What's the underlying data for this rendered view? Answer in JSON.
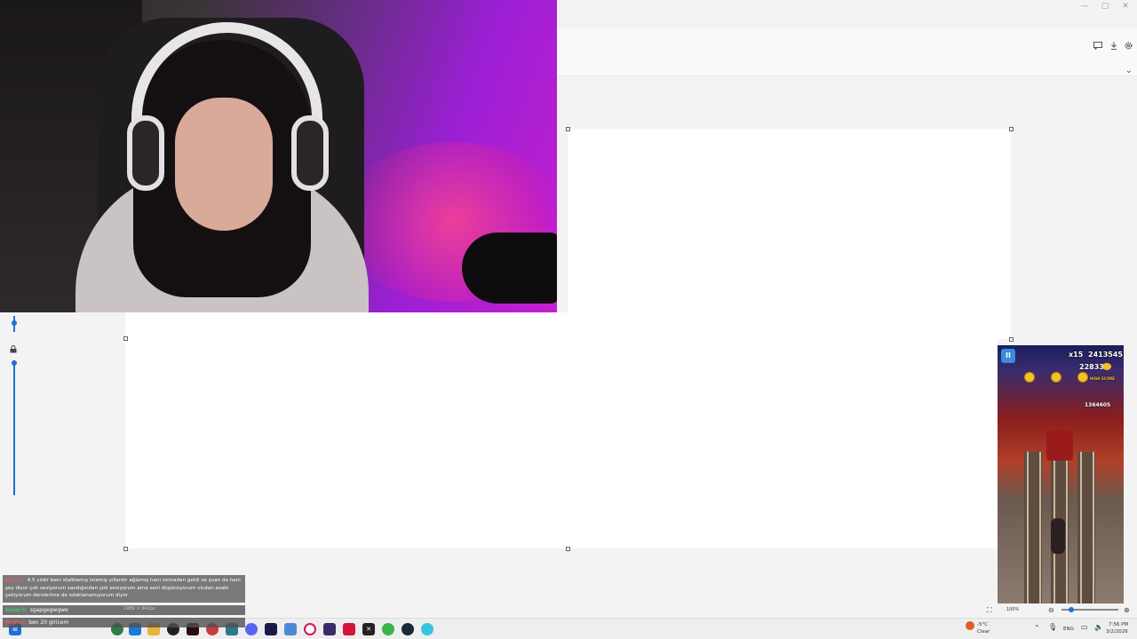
{
  "window": {
    "controls": {
      "minimize": "—",
      "maximize": "▢",
      "close": "✕"
    },
    "toolbar_icons": [
      "comment-icon",
      "download-icon",
      "settings-icon"
    ]
  },
  "chat": {
    "messages": [
      {
        "user": "Ryplol:",
        "text": "4.5 yıldır beni stalklamış istemiş yıllardır ağlamış hani sonradan geldi ve şuan da hani şey diyor çok seviyorum sandığından çok seviyorum ama seni düşünüyorum vicdan azabı çekiyorum derslerime de odaklanamıyorum diyor",
        "color": "#e25a6a"
      },
      {
        "user": "Golar3:",
        "text": "sgapgegwgwe",
        "color": "#4fc26d"
      },
      {
        "user": "Ryplol:",
        "text": "ben 20 giricem",
        "color": "#e25a6a"
      }
    ],
    "canvas_size": "1989 × 942px"
  },
  "game": {
    "multiplier": "x15",
    "score": "2413545",
    "coins": "22833",
    "high_score_label": "HIGH SCORE",
    "high_score": "1364605"
  },
  "statusbar": {
    "zoom": "100%"
  },
  "taskbar": {
    "weather_temp": "-5°C",
    "weather_desc": "Clear",
    "language": "ENG",
    "time": "7:56 PM",
    "date": "3/2/2026"
  }
}
